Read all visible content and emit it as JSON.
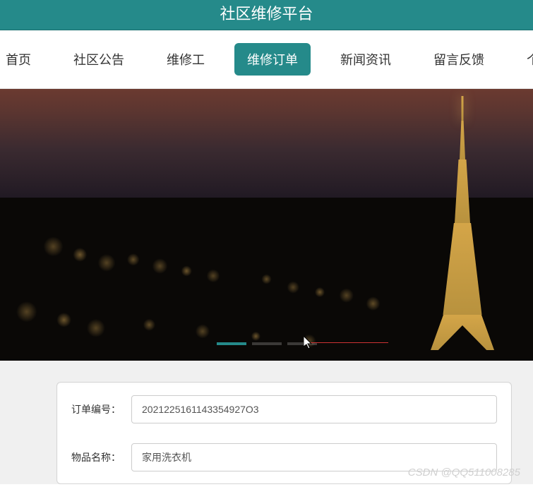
{
  "header": {
    "title": "社区维修平台"
  },
  "nav": {
    "items": [
      {
        "label": "首页",
        "active": false
      },
      {
        "label": "社区公告",
        "active": false
      },
      {
        "label": "维修工",
        "active": false
      },
      {
        "label": "维修订单",
        "active": true
      },
      {
        "label": "新闻资讯",
        "active": false
      },
      {
        "label": "留言反馈",
        "active": false
      },
      {
        "label": "个人",
        "active": false
      }
    ]
  },
  "carousel": {
    "indicator_count": 3,
    "active_index": 0
  },
  "form": {
    "fields": [
      {
        "label": "订单编号：",
        "value": "2021225161143354927O3"
      },
      {
        "label": "物品名称：",
        "value": "家用洗衣机"
      }
    ]
  },
  "watermark": "CSDN @QQ511008285"
}
